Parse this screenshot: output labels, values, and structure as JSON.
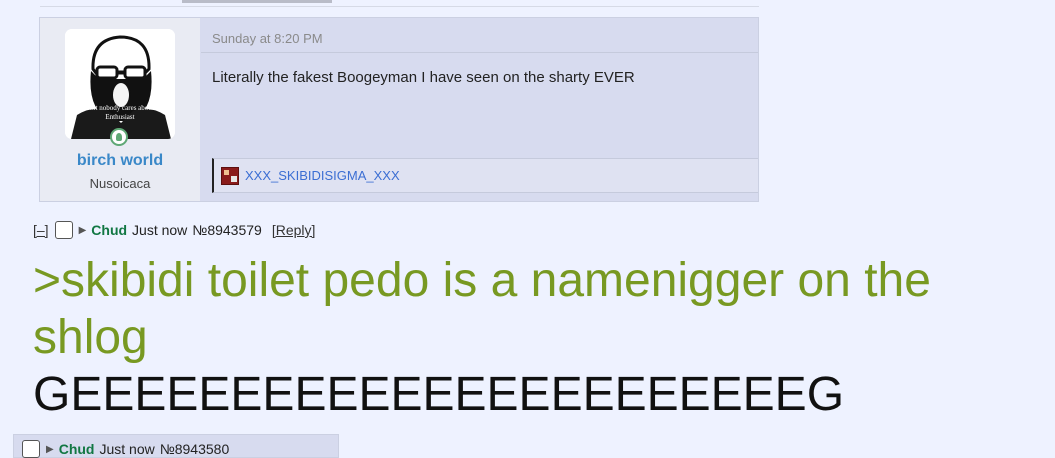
{
  "embedded_post": {
    "timestamp": "Sunday at 8:20 PM",
    "message": "Literally the fakest Boogeyman I have seen on the sharty EVER",
    "user": {
      "name": "birch world",
      "title": "Nusoicaca",
      "avatar_caption": "Shit nobody cares about Enthusiast"
    },
    "attachment": {
      "filename": "XXX_SKIBIDISIGMA_XXX",
      "icon": "image-file-icon"
    }
  },
  "post": {
    "minus": "[–]",
    "name": "Chud",
    "time": "Just now",
    "number": "№8943579",
    "reply": "[Reply]",
    "greentext": ">skibidi toilet pedo is a namenigger on the shlog",
    "text": "GEEEEEEEEEEEEEEEEEEEEEEEG"
  },
  "next_post": {
    "name": "Chud",
    "time": "Just now",
    "number": "№8943580"
  },
  "colors": {
    "background": "#eef2ff",
    "post_background": "#d7dbef",
    "greentext": "#789922",
    "poster_name": "#117743",
    "embed_username": "#3a88c8",
    "attachment_link": "#3b6ed3"
  }
}
